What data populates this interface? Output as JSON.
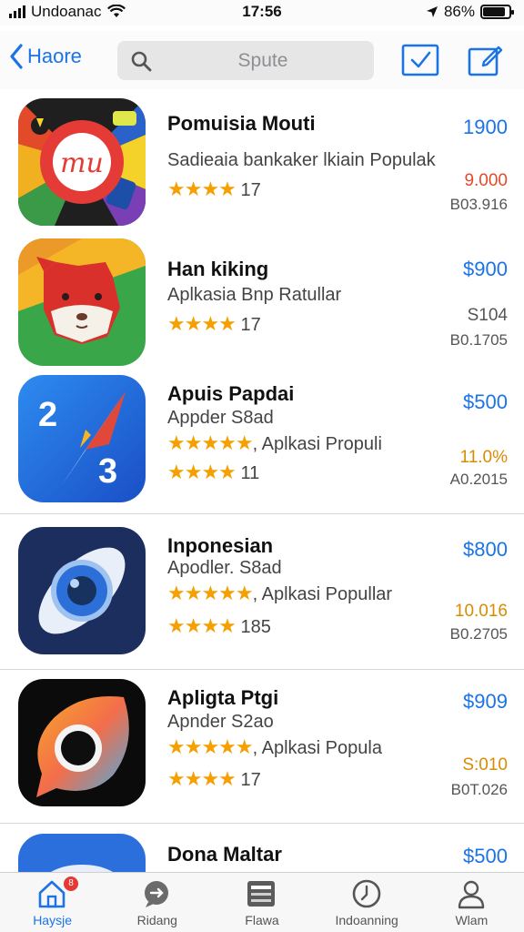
{
  "status_bar": {
    "carrier": "Undoanac",
    "time": "17:56",
    "battery": "86%"
  },
  "nav": {
    "back_label": "Haore",
    "search_placeholder": "Spute"
  },
  "apps": [
    {
      "title": "Pomuisia Mouti",
      "subtitle": "Sadieaia bankaker lkiain Populak",
      "rating_count": "17",
      "price": "1900",
      "alt_price": "9.000",
      "code": "B03.916"
    },
    {
      "title": "Han kiking",
      "subtitle": "Aplkasia Bnp Ratullar",
      "rating_count": "17",
      "price": "$900",
      "alt_price": "S104",
      "code": "B0.1705"
    },
    {
      "title": "Apuis Papdai",
      "subtitle": "Appder S8ad",
      "line3": ", Aplkasi Propuli",
      "rating_count": "11",
      "price": "$500",
      "alt_price": "11.0%",
      "code": "A0.2015"
    },
    {
      "title": "Inponesian",
      "subtitle": "Apodler. S8ad",
      "line3": ", Aplkasi Popullar",
      "rating_count": "185",
      "price": "$800",
      "alt_price": "10.016",
      "code": "B0.2705"
    },
    {
      "title": "Apligta Ptgi",
      "subtitle": "Apnder S2ao",
      "line3": ", Aplkasi Popula",
      "rating_count": "17",
      "price": "$909",
      "alt_price": "S:010",
      "code": "B0T.026"
    },
    {
      "title": "Dona Maltar",
      "price": "$500"
    }
  ],
  "tabs": [
    {
      "label": "Haysje",
      "badge": "8",
      "active": true
    },
    {
      "label": "Ridang"
    },
    {
      "label": "Flawa"
    },
    {
      "label": "Indoanning"
    },
    {
      "label": "Wlam"
    }
  ],
  "colors": {
    "accent": "#1b73e8",
    "star": "#f5a000",
    "alt_price": "#d98c00"
  }
}
